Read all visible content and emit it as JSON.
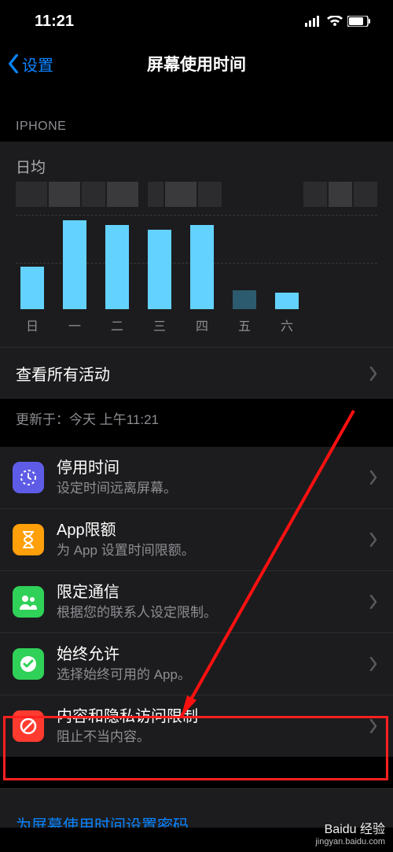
{
  "status": {
    "time": "11:21"
  },
  "nav": {
    "back": "设置",
    "title": "屏幕使用时间"
  },
  "section_header": "IPHONE",
  "chart_data": {
    "type": "bar",
    "label": "日均",
    "categories": [
      "日",
      "一",
      "二",
      "三",
      "四",
      "五",
      "六"
    ],
    "values": [
      45,
      95,
      90,
      85,
      90,
      20,
      18
    ],
    "ylim": [
      0,
      100
    ]
  },
  "link_all": "查看所有活动",
  "footer": "更新于：今天 上午11:21",
  "items": [
    {
      "title": "停用时间",
      "sub": "设定时间远离屏幕。"
    },
    {
      "title": "App限额",
      "sub": "为 App 设置时间限额。"
    },
    {
      "title": "限定通信",
      "sub": "根据您的联系人设定限制。"
    },
    {
      "title": "始终允许",
      "sub": "选择始终可用的 App。"
    },
    {
      "title": "内容和隐私访问限制",
      "sub": "阻止不当内容。"
    }
  ],
  "bottom_cut": "为屏幕使用时间设置密码",
  "watermark": {
    "brand": "Baidu 经验",
    "url": "jingyan.baidu.com"
  }
}
